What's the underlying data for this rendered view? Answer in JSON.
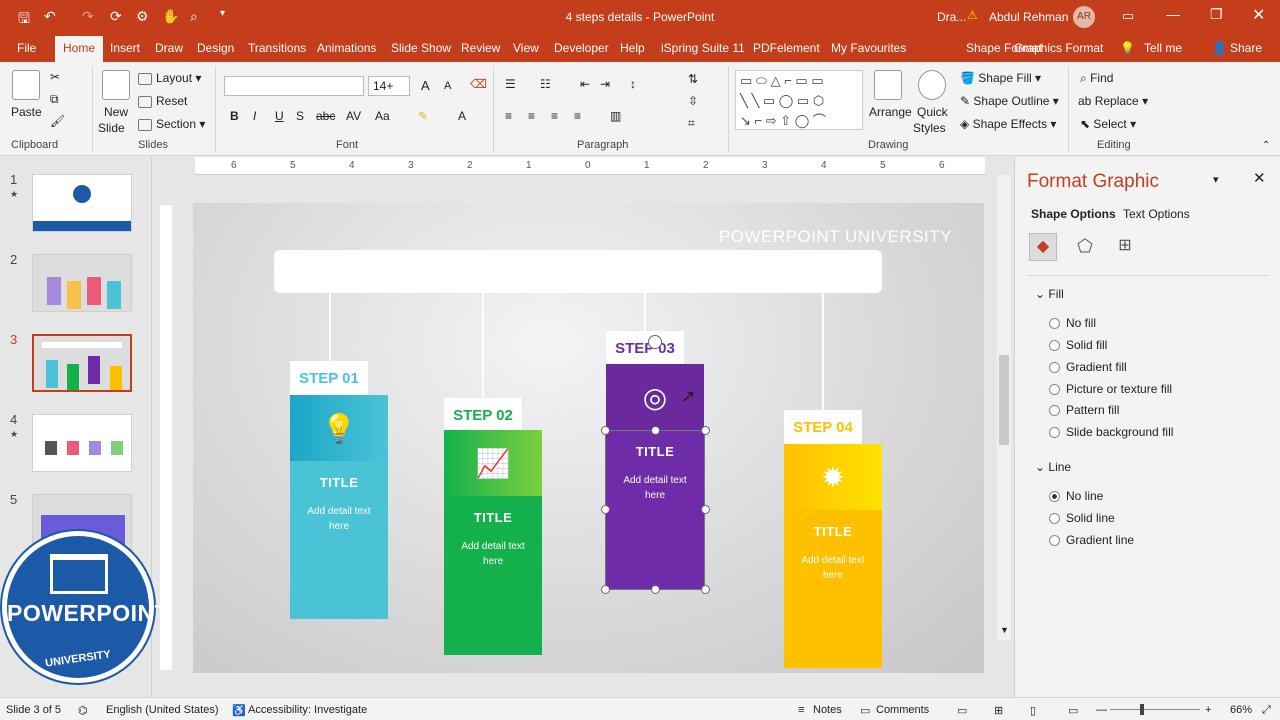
{
  "titlebar": {
    "doc_title": "4 steps details - PowerPoint",
    "user_trunc": "Dra...",
    "user": "Abdul Rehman",
    "initials": "AR"
  },
  "tabs": [
    {
      "label": "File"
    },
    {
      "label": "Home"
    },
    {
      "label": "Insert"
    },
    {
      "label": "Draw"
    },
    {
      "label": "Design"
    },
    {
      "label": "Transitions"
    },
    {
      "label": "Animations"
    },
    {
      "label": "Slide Show"
    },
    {
      "label": "Review"
    },
    {
      "label": "View"
    },
    {
      "label": "Developer"
    },
    {
      "label": "Help"
    },
    {
      "label": "iSpring Suite 11"
    },
    {
      "label": "PDFelement"
    },
    {
      "label": "My Favourites"
    },
    {
      "label": "Shape Format"
    },
    {
      "label": "Graphics Format"
    },
    {
      "label": "Tell me"
    },
    {
      "label": "Share"
    }
  ],
  "ribbon": {
    "clipboard": {
      "paste": "Paste",
      "label": "Clipboard"
    },
    "slides": {
      "new_slide": "New",
      "new_slide2": "Slide",
      "layout": "Layout",
      "reset": "Reset",
      "section": "Section",
      "label": "Slides"
    },
    "font": {
      "size": "14+",
      "label": "Font"
    },
    "paragraph": {
      "label": "Paragraph"
    },
    "drawing": {
      "arrange": "Arrange",
      "quick": "Quick",
      "styles": "Styles",
      "fill": "Shape Fill",
      "outline": "Shape Outline",
      "effects": "Shape Effects",
      "label": "Drawing"
    },
    "editing": {
      "find": "Find",
      "replace": "Replace",
      "select": "Select",
      "label": "Editing"
    }
  },
  "thumbnails": [
    {
      "num": "1",
      "star": "★"
    },
    {
      "num": "2"
    },
    {
      "num": "3"
    },
    {
      "num": "4",
      "star": "★"
    },
    {
      "num": "5"
    }
  ],
  "ruler": [
    "6",
    "5",
    "4",
    "3",
    "2",
    "1",
    "0",
    "1",
    "2",
    "3",
    "4",
    "5",
    "6"
  ],
  "slide": {
    "brand": "POWERPOINT UNIVERSITY",
    "steps": [
      {
        "label": "STEP 01",
        "title": "TITLE",
        "detail": "Add detail text here",
        "color": "#4bc3d6",
        "accent": "#54c8d8",
        "icon": "lightbulb-icon"
      },
      {
        "label": "STEP 02",
        "title": "TITLE",
        "detail": "Add detail text here",
        "color": "#14b04c",
        "accent": "#19b24f",
        "icon": "presentation-icon"
      },
      {
        "label": "STEP 03",
        "title": "TITLE",
        "detail": "Add detail text here",
        "color": "#6f2ca8",
        "accent": "#6a2a9e",
        "icon": "target-icon"
      },
      {
        "label": "STEP 04",
        "title": "TITLE",
        "detail": "Add detail text here",
        "color": "#ffc000",
        "accent": "#fbbf0e",
        "icon": "gear-icon"
      }
    ]
  },
  "pane": {
    "title": "Format Graphic",
    "tabs": [
      "Shape Options",
      "Text Options"
    ],
    "fill_header": "Fill",
    "fill_options": [
      {
        "label": "No fill"
      },
      {
        "label": "Solid fill"
      },
      {
        "label": "Gradient fill"
      },
      {
        "label": "Picture or texture fill"
      },
      {
        "label": "Pattern fill"
      },
      {
        "label": "Slide background fill"
      }
    ],
    "line_header": "Line",
    "line_options": [
      {
        "label": "No line",
        "selected": true
      },
      {
        "label": "Solid line"
      },
      {
        "label": "Gradient line"
      }
    ]
  },
  "status": {
    "slide": "Slide 3 of 5",
    "lang": "English (United States)",
    "access": "Accessibility: Investigate",
    "notes": "Notes",
    "comments": "Comments",
    "zoom": "66%"
  },
  "logo": {
    "line1": "POWERPOINT",
    "line2": "UNIVERSITY"
  }
}
